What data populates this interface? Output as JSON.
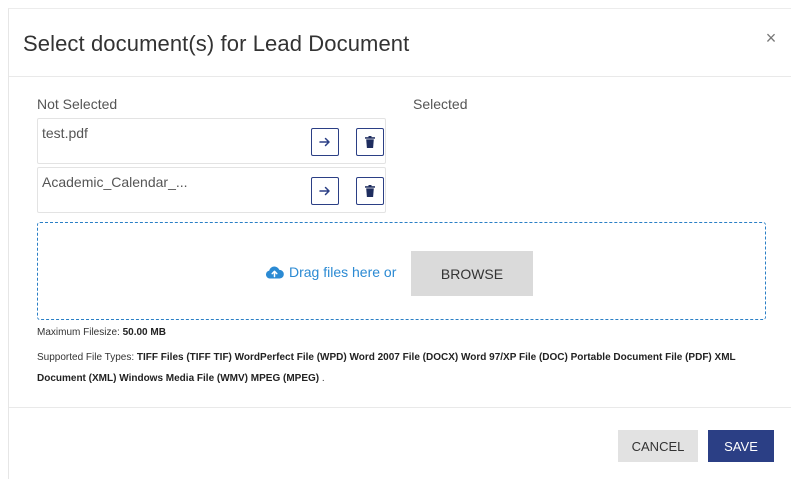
{
  "modal": {
    "title": "Select document(s) for Lead Document",
    "close_icon": "×"
  },
  "columns": {
    "not_selected_label": "Not Selected",
    "selected_label": "Selected"
  },
  "files": [
    {
      "name": "test.pdf"
    },
    {
      "name": "Academic_Calendar_..."
    }
  ],
  "icons": {
    "move": "arrow-right-icon",
    "delete": "trash-icon",
    "upload": "cloud-upload-icon"
  },
  "dropzone": {
    "text": "Drag files here or",
    "browse_label": "BROWSE"
  },
  "info": {
    "max_label": "Maximum Filesize:",
    "max_value": "50.00 MB",
    "types_label": "Supported File Types:",
    "types_value": "TIFF Files (TIFF TIF) WordPerfect File (WPD) Word 2007 File (DOCX) Word 97/XP File (DOC) Portable Document File (PDF) XML Document (XML) Windows Media File (WMV) MPEG (MPEG)",
    "types_suffix": "."
  },
  "footer": {
    "cancel_label": "CANCEL",
    "save_label": "SAVE"
  },
  "colors": {
    "primary": "#2b3f85",
    "link": "#2b8ad3",
    "button_gray": "#e2e2e2"
  }
}
